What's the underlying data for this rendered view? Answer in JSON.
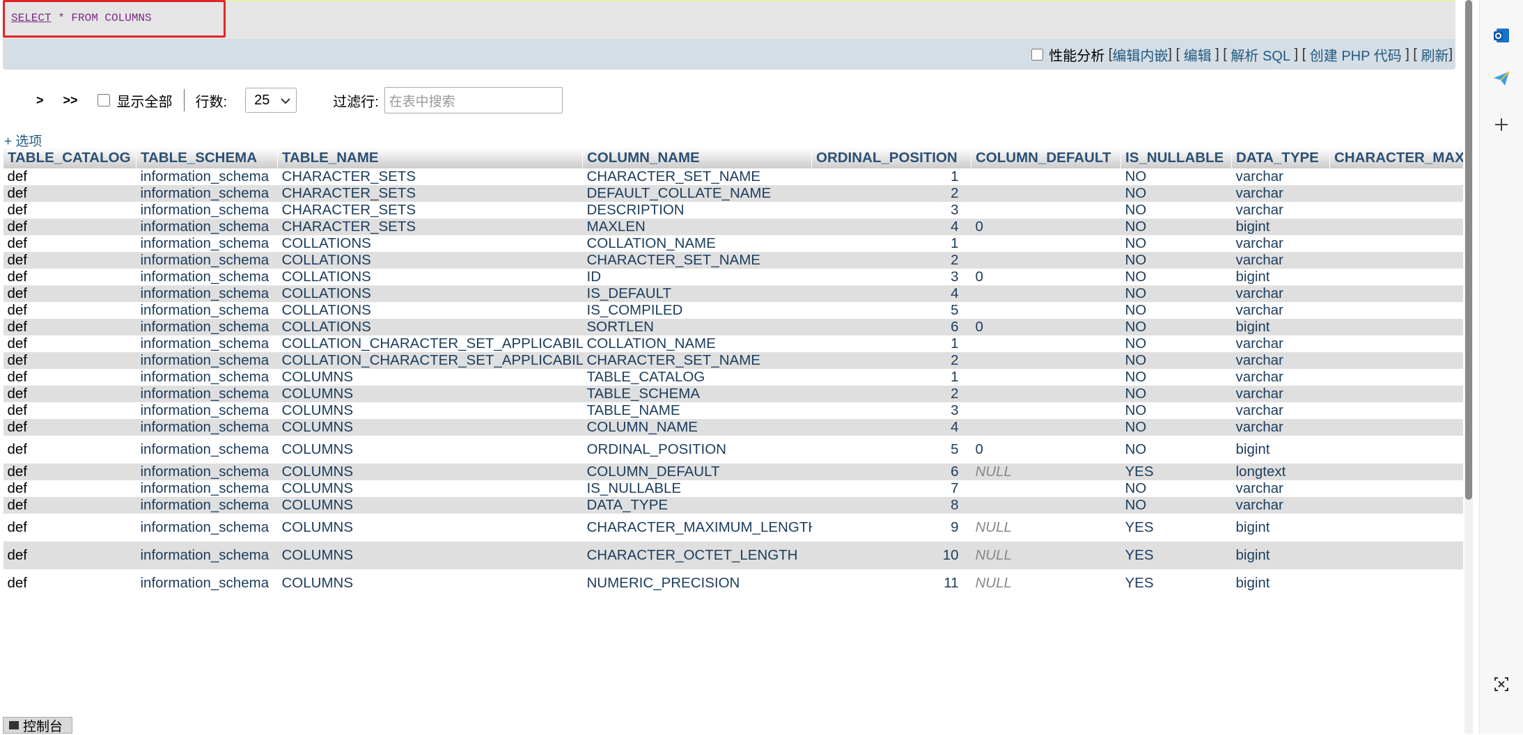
{
  "sql": {
    "keyword": "SELECT",
    "rest": " * FROM COLUMNS"
  },
  "actions": {
    "profiling": "性能分析",
    "links": [
      "编辑内嵌",
      "编辑",
      "解析 SQL",
      "创建 PHP 代码",
      "刷新"
    ]
  },
  "nav": {
    "next": ">",
    "last": ">>",
    "show_all": "显示全部",
    "rows_label": "行数:",
    "rows_value": "25",
    "filter_label": "过滤行:",
    "filter_placeholder": "在表中搜索"
  },
  "options_link": "+ 选项",
  "table": {
    "columns": [
      "TABLE_CATALOG",
      "TABLE_SCHEMA",
      "TABLE_NAME",
      "COLUMN_NAME",
      "ORDINAL_POSITION",
      "COLUMN_DEFAULT",
      "IS_NULLABLE",
      "DATA_TYPE",
      "CHARACTER_MAXIMUM_LENGTH"
    ],
    "rows": [
      [
        "def",
        "information_schema",
        "CHARACTER_SETS",
        "CHARACTER_SET_NAME",
        "1",
        "",
        "NO",
        "varchar",
        ""
      ],
      [
        "def",
        "information_schema",
        "CHARACTER_SETS",
        "DEFAULT_COLLATE_NAME",
        "2",
        "",
        "NO",
        "varchar",
        ""
      ],
      [
        "def",
        "information_schema",
        "CHARACTER_SETS",
        "DESCRIPTION",
        "3",
        "",
        "NO",
        "varchar",
        ""
      ],
      [
        "def",
        "information_schema",
        "CHARACTER_SETS",
        "MAXLEN",
        "4",
        "0",
        "NO",
        "bigint",
        ""
      ],
      [
        "def",
        "information_schema",
        "COLLATIONS",
        "COLLATION_NAME",
        "1",
        "",
        "NO",
        "varchar",
        ""
      ],
      [
        "def",
        "information_schema",
        "COLLATIONS",
        "CHARACTER_SET_NAME",
        "2",
        "",
        "NO",
        "varchar",
        ""
      ],
      [
        "def",
        "information_schema",
        "COLLATIONS",
        "ID",
        "3",
        "0",
        "NO",
        "bigint",
        ""
      ],
      [
        "def",
        "information_schema",
        "COLLATIONS",
        "IS_DEFAULT",
        "4",
        "",
        "NO",
        "varchar",
        ""
      ],
      [
        "def",
        "information_schema",
        "COLLATIONS",
        "IS_COMPILED",
        "5",
        "",
        "NO",
        "varchar",
        ""
      ],
      [
        "def",
        "information_schema",
        "COLLATIONS",
        "SORTLEN",
        "6",
        "0",
        "NO",
        "bigint",
        ""
      ],
      [
        "def",
        "information_schema",
        "COLLATION_CHARACTER_SET_APPLICABILITY",
        "COLLATION_NAME",
        "1",
        "",
        "NO",
        "varchar",
        ""
      ],
      [
        "def",
        "information_schema",
        "COLLATION_CHARACTER_SET_APPLICABILITY",
        "CHARACTER_SET_NAME",
        "2",
        "",
        "NO",
        "varchar",
        ""
      ],
      [
        "def",
        "information_schema",
        "COLUMNS",
        "TABLE_CATALOG",
        "1",
        "",
        "NO",
        "varchar",
        ""
      ],
      [
        "def",
        "information_schema",
        "COLUMNS",
        "TABLE_SCHEMA",
        "2",
        "",
        "NO",
        "varchar",
        ""
      ],
      [
        "def",
        "information_schema",
        "COLUMNS",
        "TABLE_NAME",
        "3",
        "",
        "NO",
        "varchar",
        ""
      ],
      [
        "def",
        "information_schema",
        "COLUMNS",
        "COLUMN_NAME",
        "4",
        "",
        "NO",
        "varchar",
        ""
      ],
      [
        "def",
        "information_schema",
        "COLUMNS",
        "ORDINAL_POSITION",
        "5",
        "0",
        "NO",
        "bigint",
        ""
      ],
      [
        "def",
        "information_schema",
        "COLUMNS",
        "COLUMN_DEFAULT",
        "6",
        "NULL",
        "YES",
        "longtext",
        ""
      ],
      [
        "def",
        "information_schema",
        "COLUMNS",
        "IS_NULLABLE",
        "7",
        "",
        "NO",
        "varchar",
        ""
      ],
      [
        "def",
        "information_schema",
        "COLUMNS",
        "DATA_TYPE",
        "8",
        "",
        "NO",
        "varchar",
        ""
      ],
      [
        "def",
        "information_schema",
        "COLUMNS",
        "CHARACTER_MAXIMUM_LENGTH",
        "9",
        "NULL",
        "YES",
        "bigint",
        ""
      ],
      [
        "def",
        "information_schema",
        "COLUMNS",
        "CHARACTER_OCTET_LENGTH",
        "10",
        "NULL",
        "YES",
        "bigint",
        ""
      ],
      [
        "def",
        "information_schema",
        "COLUMNS",
        "NUMERIC_PRECISION",
        "11",
        "NULL",
        "YES",
        "bigint",
        ""
      ]
    ]
  },
  "console": "控制台",
  "side_icons": [
    "outlook-icon",
    "send-icon",
    "plus-icon",
    "screenshot-icon"
  ]
}
